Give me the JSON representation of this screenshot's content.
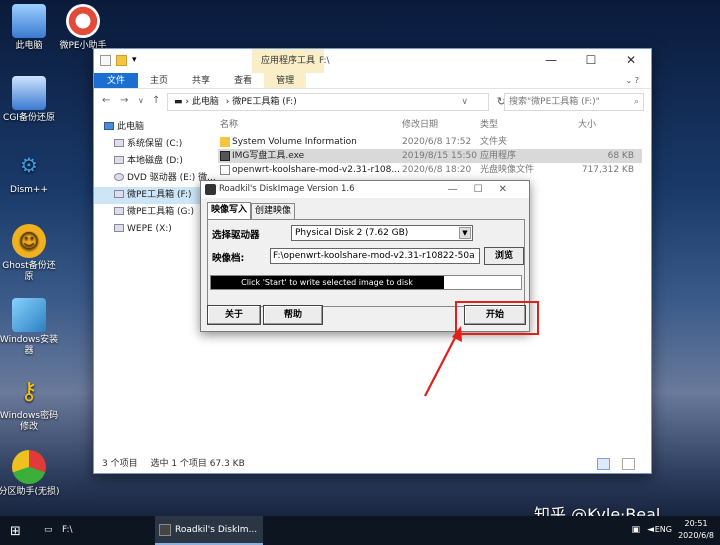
{
  "desktop_icons": [
    {
      "label": "此电脑",
      "icon": "computer-icon",
      "color": "#4a8ad8"
    },
    {
      "label": "微PE小助手",
      "icon": "lifebuoy-icon",
      "color": "#e34a3a"
    },
    {
      "label": "CGI备份还原",
      "icon": "backup-icon",
      "color": "#3a7ad0"
    },
    {
      "label": "Dism++",
      "icon": "gear-icon",
      "color": "#3a9ae0"
    },
    {
      "label": "Ghost备份还原",
      "icon": "ghost-icon",
      "color": "#f0b020"
    },
    {
      "label": "Windows安装器",
      "icon": "installer-icon",
      "color": "#5ab0e0"
    },
    {
      "label": "Windows密码修改",
      "icon": "key-icon",
      "color": "#f0c020"
    },
    {
      "label": "分区助手(无损)",
      "icon": "partition-icon",
      "color": "#e03a3a"
    }
  ],
  "explorer": {
    "context_tab": "应用程序工具",
    "title": "F:\\",
    "ribbon": {
      "file": "文件",
      "home": "主页",
      "share": "共享",
      "view": "查看",
      "manage": "管理"
    },
    "address": [
      "此电脑",
      "微PE工具箱 (F:)"
    ],
    "search_placeholder": "搜索\"微PE工具箱 (F:)\"",
    "nav": [
      {
        "label": "此电脑",
        "root": true
      },
      {
        "label": "系统保留 (C:)"
      },
      {
        "label": "本地磁盘 (D:)"
      },
      {
        "label": "DVD 驱动器 (E:) 微..."
      },
      {
        "label": "微PE工具箱 (F:)",
        "selected": true
      },
      {
        "label": "微PE工具箱 (G:)"
      },
      {
        "label": "WEPE (X:)"
      }
    ],
    "columns": {
      "name": "名称",
      "date": "修改日期",
      "type": "类型",
      "size": "大小"
    },
    "files": [
      {
        "name": "System Volume Information",
        "date": "2020/6/8 17:52",
        "type": "文件夹",
        "size": "",
        "icon": "folder-icon"
      },
      {
        "name": "IMG写盘工具.exe",
        "date": "2019/8/15 15:50",
        "type": "应用程序",
        "size": "68 KB",
        "icon": "exe-icon",
        "selected": true
      },
      {
        "name": "openwrt-koolshare-mod-v2.31-r108...",
        "date": "2020/6/8 18:20",
        "type": "光盘映像文件",
        "size": "717,312 KB",
        "icon": "image-file-icon"
      }
    ],
    "status": {
      "count": "3 个项目",
      "selected": "选中 1 个项目  67.3 KB"
    }
  },
  "dialog": {
    "title": "Roadkil's DiskImage Version 1.6",
    "tabs": [
      "映像写入",
      "创建映像"
    ],
    "drive_label": "选择驱动器",
    "drive_value": "Physical Disk 2 (7.62 GB)",
    "image_label": "映像档:",
    "image_path": "F:\\openwrt-koolshare-mod-v2.31-r10822-50a",
    "browse": "浏览",
    "progress_text": "Click 'Start' to write selected image to disk",
    "progress_fraction": 0.75,
    "about": "关于",
    "help": "帮助",
    "start": "开始"
  },
  "taskbar": {
    "explorer_item": "F:\\",
    "app_item": "Roadkil's DiskIm...",
    "lang": "ENG",
    "time": "20:51",
    "date": "2020/6/8"
  },
  "watermark": "知乎 @Kyle·Beal",
  "accent": "#e0201a"
}
